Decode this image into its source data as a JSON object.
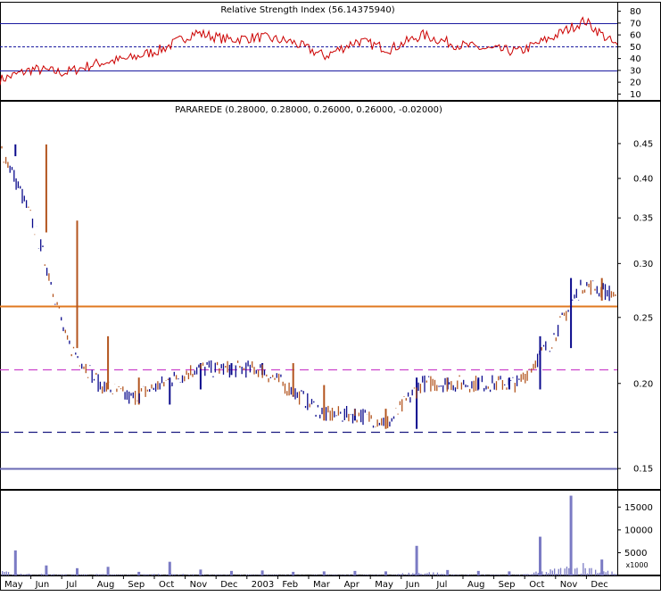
{
  "chart_data": [
    {
      "type": "line",
      "title": "Relative Strength Index (56.14375940)",
      "ylim": [
        5,
        88
      ],
      "yticks": [
        10,
        20,
        30,
        40,
        50,
        60,
        70,
        80
      ],
      "reference_lines": [
        {
          "value": 70,
          "style": "solid",
          "color": "#1a1aa0"
        },
        {
          "value": 50,
          "style": "dotted",
          "color": "#1a1aa0"
        },
        {
          "value": 30,
          "style": "solid",
          "color": "#1a1aa0"
        }
      ],
      "color": "#cc0000",
      "x": [
        "May",
        "Jun",
        "Jul",
        "Aug",
        "Sep",
        "Oct",
        "Nov",
        "Dec",
        "2003",
        "Feb",
        "Mar",
        "Apr",
        "May",
        "Jun",
        "Jul",
        "Aug",
        "Sep",
        "Oct",
        "Nov",
        "Dec"
      ],
      "values": [
        22,
        31,
        28,
        36,
        40,
        48,
        62,
        56,
        58,
        54,
        42,
        55,
        48,
        60,
        52,
        48,
        46,
        58,
        72,
        50
      ]
    },
    {
      "type": "bar",
      "subtype": "ohlc",
      "title": "PARAREDE (0.28000, 0.28000, 0.26000, 0.26000, -0.02000)",
      "scale": "log",
      "ylim": [
        0.14,
        0.52
      ],
      "yticks": [
        0.15,
        0.2,
        0.25,
        0.3,
        0.35,
        0.4,
        0.45
      ],
      "up_color": "#0a0a8c",
      "down_color": "#b3541e",
      "x": [
        "May",
        "Jun",
        "Jul",
        "Aug",
        "Sep",
        "Oct",
        "Nov",
        "Dec",
        "2003",
        "Feb",
        "Mar",
        "Apr",
        "May",
        "Jun",
        "Jul",
        "Aug",
        "Sep",
        "Oct",
        "Nov",
        "Dec"
      ],
      "values": [
        0.44,
        0.34,
        0.23,
        0.2,
        0.19,
        0.2,
        0.21,
        0.21,
        0.21,
        0.195,
        0.18,
        0.18,
        0.175,
        0.2,
        0.2,
        0.2,
        0.2,
        0.23,
        0.28,
        0.27
      ],
      "reference_lines": [
        {
          "value": 0.26,
          "style": "solid",
          "color": "#e07820"
        },
        {
          "value": 0.21,
          "style": "dashed",
          "color": "#cc44cc"
        },
        {
          "value": 0.17,
          "style": "dashed",
          "color": "#1a1a80"
        },
        {
          "value": 0.15,
          "style": "solid",
          "color": "#6a6ab4"
        }
      ]
    },
    {
      "type": "bar",
      "subtype": "volume",
      "unit_label": "x1000",
      "ylim": [
        0,
        18000
      ],
      "yticks": [
        5000,
        10000,
        15000
      ],
      "color": "#7b7bc4",
      "x": [
        "May",
        "Jun",
        "Jul",
        "Aug",
        "Sep",
        "Oct",
        "Nov",
        "Dec",
        "2003",
        "Feb",
        "Mar",
        "Apr",
        "May",
        "Jun",
        "Jul",
        "Aug",
        "Sep",
        "Oct",
        "Nov",
        "Dec"
      ],
      "values": [
        5500,
        2200,
        1600,
        1900,
        800,
        3000,
        1300,
        1000,
        1100,
        800,
        900,
        1000,
        900,
        6500,
        1200,
        1000,
        900,
        8500,
        17500,
        3500
      ]
    }
  ]
}
